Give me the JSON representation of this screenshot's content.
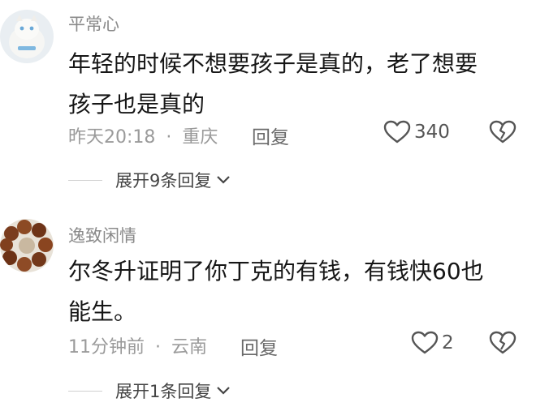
{
  "comments": [
    {
      "username": "平常心",
      "content": [
        "年轻的时候不想要孩子是真的，老了想要",
        "孩子也是真的"
      ],
      "time": "昨天20:18",
      "sep": "·",
      "location": "重庆",
      "reply_label": "回复",
      "likes": "340",
      "expand_label": "展开9条回复"
    },
    {
      "username": "逸致闲情",
      "content": [
        "尔冬升证明了你丁克的有钱，有钱快60也",
        "能生。"
      ],
      "time": "11分钟前",
      "sep": "·",
      "location": "云南",
      "reply_label": "回复",
      "likes": "2",
      "expand_label": "展开1条回复"
    }
  ]
}
